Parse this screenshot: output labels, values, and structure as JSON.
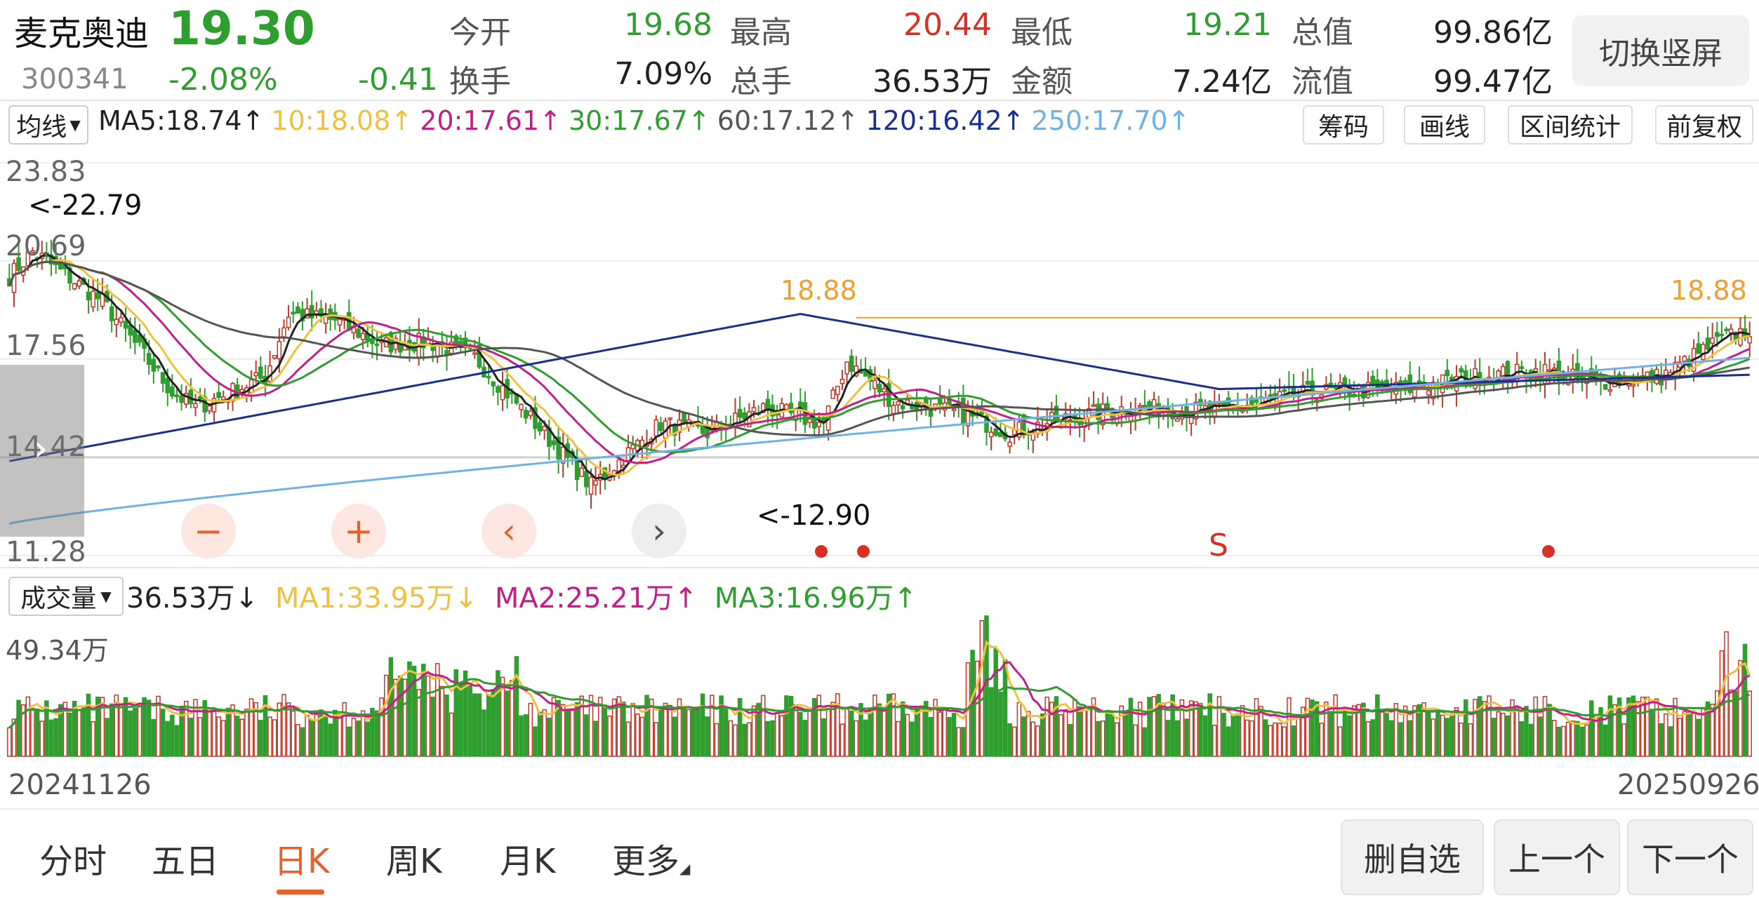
{
  "stock": {
    "name": "麦克奥迪",
    "price": "19.30",
    "code": "300341",
    "change_pct": "-2.08%",
    "change_amt": "-0.41"
  },
  "quote": [
    [
      {
        "label": "今开",
        "value": "19.68",
        "color": "green"
      },
      {
        "label": "最高",
        "value": "20.44",
        "color": "red"
      },
      {
        "label": "最低",
        "value": "19.21",
        "color": "green"
      },
      {
        "label": "总值",
        "value": "99.86亿",
        "color": "dark"
      }
    ],
    [
      {
        "label": "换手",
        "value": "7.09%",
        "color": "dark"
      },
      {
        "label": "总手",
        "value": "36.53万",
        "color": "dark"
      },
      {
        "label": "金额",
        "value": "7.24亿",
        "color": "dark"
      },
      {
        "label": "流值",
        "value": "99.47亿",
        "color": "dark"
      }
    ]
  ],
  "switch_label": "切换竖屏",
  "ma_selector": "均线",
  "ma_items": [
    {
      "text": "MA5:18.74",
      "arrow": "↑",
      "color": "#222222"
    },
    {
      "text": "10:18.08",
      "arrow": "↑",
      "color": "#f0c040"
    },
    {
      "text": "20:17.61",
      "arrow": "↑",
      "color": "#c21f8a"
    },
    {
      "text": "30:17.67",
      "arrow": "↑",
      "color": "#2e9e2e"
    },
    {
      "text": "60:17.12",
      "arrow": "↑",
      "color": "#555555"
    },
    {
      "text": "120:16.42",
      "arrow": "↑",
      "color": "#1a2f8f"
    },
    {
      "text": "250:17.70",
      "arrow": "↑",
      "color": "#6fb3e6"
    }
  ],
  "tools": [
    "筹码",
    "画线",
    "区间统计",
    "前复权"
  ],
  "price_axis": [
    "23.83",
    "20.69",
    "17.56",
    "14.42",
    "11.28"
  ],
  "annotations": {
    "high": "<-22.79",
    "low": "<-12.90",
    "level_left": "18.88",
    "level_right": "18.88",
    "signal": "S"
  },
  "controls": [
    "−",
    "+",
    "‹",
    "›"
  ],
  "vol_selector": "成交量",
  "vol_items": [
    {
      "text": "36.53万",
      "arrow": "↓",
      "color": "#222222"
    },
    {
      "text": "MA1:33.95万",
      "arrow": "↓",
      "color": "#f0c040"
    },
    {
      "text": "MA2:25.21万",
      "arrow": "↑",
      "color": "#c21f8a"
    },
    {
      "text": "MA3:16.96万",
      "arrow": "↑",
      "color": "#2e9e2e"
    }
  ],
  "vol_axis": "49.34万",
  "dates": {
    "start": "20241126",
    "end": "20250926"
  },
  "tabs": [
    "分时",
    "五日",
    "日K",
    "周K",
    "月K",
    "更多"
  ],
  "active_tab": "日K",
  "bottom_buttons": [
    "删自选",
    "上一个",
    "下一个"
  ],
  "colors": {
    "up": "#c0392b",
    "down": "#2e9e2e",
    "ma5": "#222222",
    "ma10": "#f0c040",
    "ma20": "#c21f8a",
    "ma30": "#2e9e2e",
    "ma60": "#555555",
    "ma120": "#1a2f8f",
    "ma250": "#6fb3e6",
    "level": "#f0a030",
    "active": "#e8602c"
  },
  "chart_data": {
    "type": "candlestick",
    "range": [
      "20241126",
      "20250926"
    ],
    "ylim": [
      11.28,
      23.83
    ],
    "y_ticks": [
      23.83,
      20.69,
      17.56,
      14.42,
      11.28
    ],
    "close_keypoints": [
      [
        0,
        20.2
      ],
      [
        5,
        21.0
      ],
      [
        20,
        19.4
      ],
      [
        35,
        16.5
      ],
      [
        40,
        16.0
      ],
      [
        55,
        17.0
      ],
      [
        60,
        19.0
      ],
      [
        70,
        18.8
      ],
      [
        80,
        18.0
      ],
      [
        90,
        18.1
      ],
      [
        100,
        17.6
      ],
      [
        110,
        16.0
      ],
      [
        125,
        13.5
      ],
      [
        140,
        15.5
      ],
      [
        150,
        15.2
      ],
      [
        162,
        16.0
      ],
      [
        175,
        15.5
      ],
      [
        180,
        17.5
      ],
      [
        190,
        16.2
      ],
      [
        205,
        15.8
      ],
      [
        215,
        15.2
      ],
      [
        225,
        15.6
      ],
      [
        240,
        16.0
      ],
      [
        260,
        15.9
      ],
      [
        280,
        16.5
      ],
      [
        300,
        16.6
      ],
      [
        315,
        17.0
      ],
      [
        330,
        17.2
      ],
      [
        340,
        16.8
      ],
      [
        355,
        17.0
      ],
      [
        368,
        18.2
      ],
      [
        374,
        18.5
      ]
    ],
    "volume_ylim": [
      0,
      49.34
    ],
    "volume_unit": "万",
    "last_volume": 36.53
  }
}
